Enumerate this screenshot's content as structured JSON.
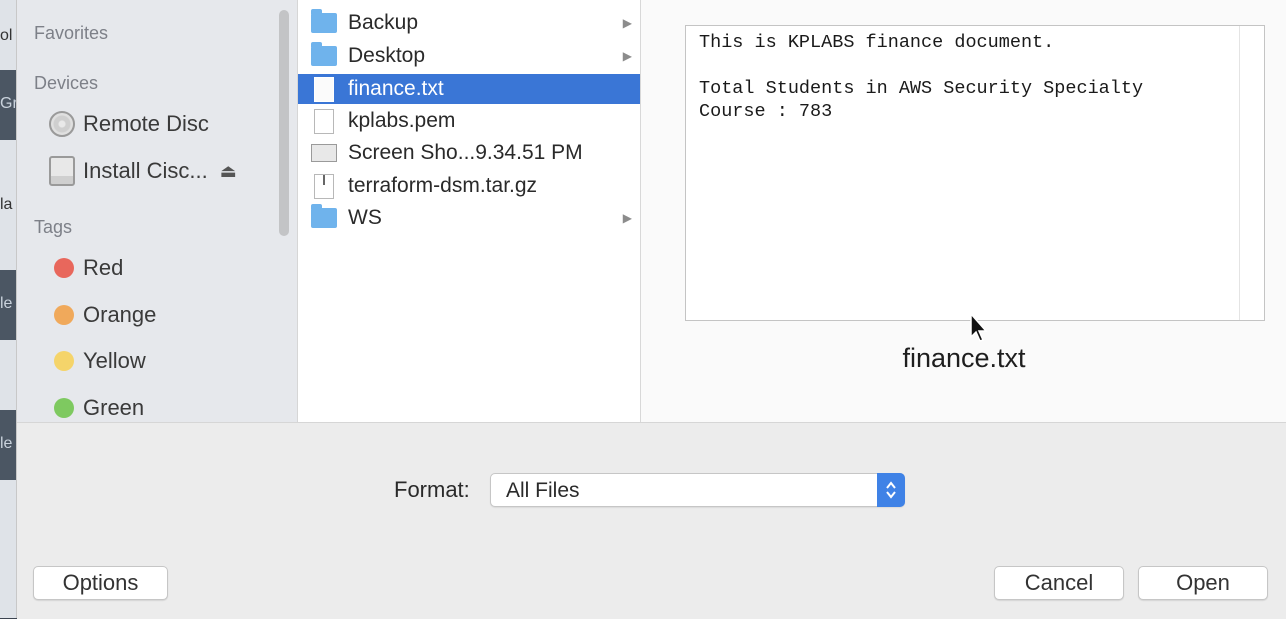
{
  "background_app": {
    "fragments": [
      "ol",
      "Gr",
      "la",
      "le",
      "le"
    ]
  },
  "sidebar": {
    "favorites_heading": "Favorites",
    "devices_heading": "Devices",
    "devices": [
      {
        "label": "Remote Disc",
        "icon": "disc-icon"
      },
      {
        "label": "Install Cisc...",
        "icon": "drive-icon",
        "eject": "⏏"
      }
    ],
    "tags_heading": "Tags",
    "tags": [
      {
        "label": "Red",
        "color": "#e8675c"
      },
      {
        "label": "Orange",
        "color": "#f0a95b"
      },
      {
        "label": "Yellow",
        "color": "#f5d46a"
      },
      {
        "label": "Green",
        "color": "#7ec960"
      }
    ]
  },
  "files": [
    {
      "name": "Backup",
      "kind": "folder",
      "has_children": true,
      "arrow": "▶"
    },
    {
      "name": "Desktop",
      "kind": "folder",
      "has_children": true,
      "arrow": "▶"
    },
    {
      "name": "finance.txt",
      "kind": "document",
      "selected": true
    },
    {
      "name": "kplabs.pem",
      "kind": "document"
    },
    {
      "name": "Screen Sho...9.34.51 PM",
      "kind": "screenshot"
    },
    {
      "name": "terraform-dsm.tar.gz",
      "kind": "archive"
    },
    {
      "name": "WS",
      "kind": "folder",
      "has_children": true,
      "arrow": "▶"
    }
  ],
  "preview": {
    "content": "This is KPLABS finance document.\n\nTotal Students in AWS Security Specialty\nCourse : 783",
    "filename": "finance.txt"
  },
  "format": {
    "label": "Format:",
    "selected": "All Files"
  },
  "buttons": {
    "options": "Options",
    "cancel": "Cancel",
    "open": "Open"
  },
  "colors": {
    "selection": "#3a76d6",
    "accent": "#3f82e6"
  }
}
